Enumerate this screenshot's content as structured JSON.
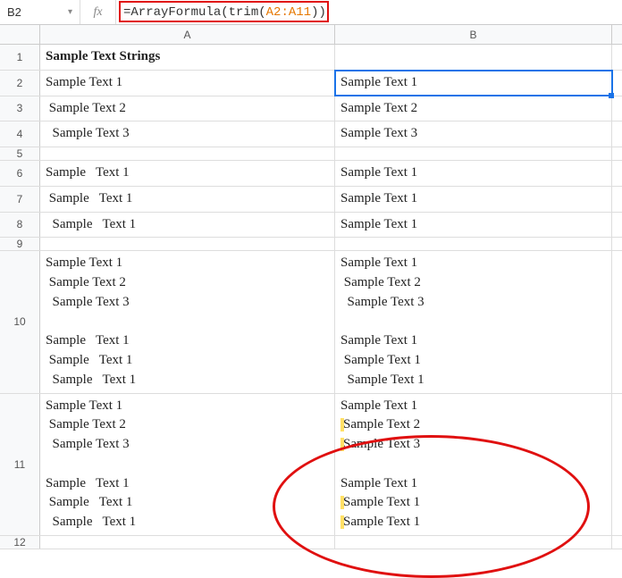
{
  "formula_bar": {
    "cell_ref": "B2",
    "fx_label": "fx",
    "formula_prefix": "=ArrayFormula(trim(",
    "formula_arg": "A2:A11",
    "formula_suffix": "))"
  },
  "columns": {
    "a": "A",
    "b": "B"
  },
  "rows": [
    {
      "n": "1",
      "a": "Sample Text Strings",
      "b": "",
      "bold": true
    },
    {
      "n": "2",
      "a": "Sample Text 1",
      "b": "Sample Text 1",
      "active_b": true
    },
    {
      "n": "3",
      "a": " Sample Text 2",
      "b": "Sample Text 2"
    },
    {
      "n": "4",
      "a": "  Sample Text 3",
      "b": "Sample Text 3"
    },
    {
      "n": "5",
      "a": "",
      "b": ""
    },
    {
      "n": "6",
      "a": "Sample   Text 1",
      "b": "Sample Text 1"
    },
    {
      "n": "7",
      "a": " Sample   Text 1",
      "b": "Sample Text 1"
    },
    {
      "n": "8",
      "a": "  Sample   Text 1",
      "b": "Sample Text 1"
    },
    {
      "n": "9",
      "a": "",
      "b": ""
    },
    {
      "n": "10",
      "multiline": true,
      "a_lines": [
        "Sample Text 1",
        " Sample Text 2",
        "  Sample Text 3",
        "",
        "Sample   Text 1",
        " Sample   Text 1",
        "  Sample   Text 1"
      ],
      "b_lines": [
        {
          "pre": "",
          "txt": "Sample Text 1"
        },
        {
          "pre": " ",
          "txt": "Sample Text 2"
        },
        {
          "pre": "  ",
          "txt": "Sample Text 3"
        },
        {
          "pre": "",
          "txt": ""
        },
        {
          "pre": "",
          "txt": "Sample Text 1"
        },
        {
          "pre": " ",
          "txt": "Sample Text 1"
        },
        {
          "pre": "  ",
          "txt": "Sample Text 1"
        }
      ]
    },
    {
      "n": "11",
      "multiline": true,
      "a_lines": [
        "Sample Text 1",
        " Sample Text 2",
        "  Sample Text 3",
        "",
        "Sample   Text 1",
        " Sample   Text 1",
        "  Sample   Text 1"
      ],
      "b_lines": [
        {
          "pre": "",
          "txt": "Sample Text 1",
          "hl": false
        },
        {
          "pre": "",
          "txt": "Sample Text 2",
          "hl": true
        },
        {
          "pre": "",
          "txt": "Sample Text 3",
          "hl": true
        },
        {
          "pre": "",
          "txt": "",
          "hl": false
        },
        {
          "pre": "",
          "txt": "Sample Text 1",
          "hl": false
        },
        {
          "pre": "",
          "txt": "Sample Text 1",
          "hl": true
        },
        {
          "pre": "",
          "txt": "Sample Text 1",
          "hl": true
        }
      ]
    },
    {
      "n": "12",
      "a": "",
      "b": ""
    }
  ]
}
